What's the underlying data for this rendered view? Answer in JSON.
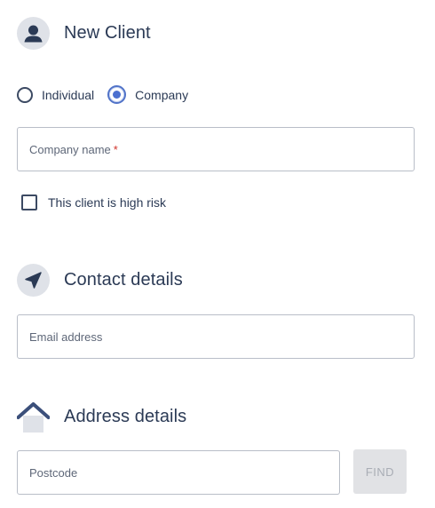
{
  "new_client": {
    "title": "New Client",
    "icon": "user-icon",
    "client_type": {
      "options": [
        {
          "label": "Individual",
          "selected": false
        },
        {
          "label": "Company",
          "selected": true
        }
      ]
    },
    "company_name": {
      "label": "Company name",
      "required_mark": "*",
      "value": ""
    },
    "high_risk": {
      "label": "This client is high risk",
      "checked": false
    }
  },
  "contact_details": {
    "title": "Contact details",
    "icon": "send-icon",
    "email": {
      "label": "Email address",
      "value": ""
    }
  },
  "address_details": {
    "title": "Address details",
    "icon": "home-icon",
    "postcode": {
      "label": "Postcode",
      "value": ""
    },
    "find_button": {
      "label": "FIND",
      "enabled": false
    }
  },
  "colors": {
    "text": "#2b3a55",
    "accent": "#4a6fd0",
    "required": "#d0342c",
    "icon_bg": "#dfe2e8",
    "field_border": "#b9bec8",
    "disabled_button_bg": "#e1e2e5"
  }
}
